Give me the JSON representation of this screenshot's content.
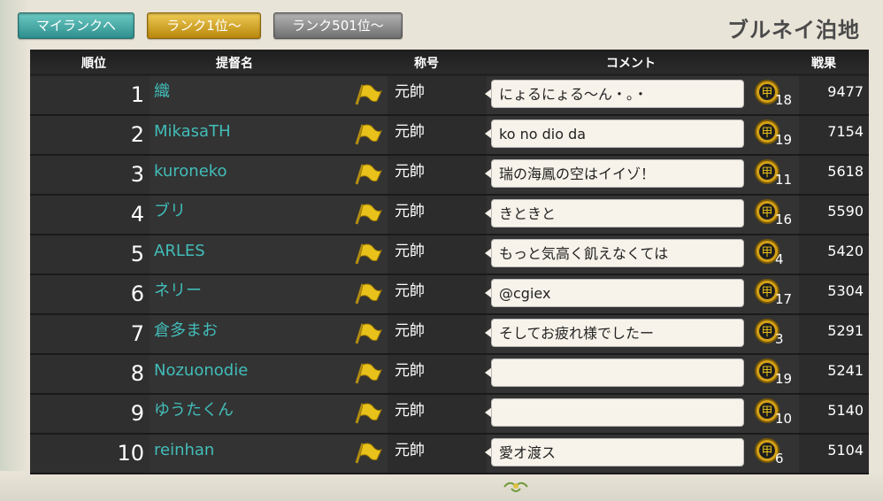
{
  "tabs": {
    "my_rank": "マイランクへ",
    "rank1": "ランク1位～",
    "rank501": "ランク501位～"
  },
  "base_name": "ブルネイ泊地",
  "header": {
    "rank": "順位",
    "name": "提督名",
    "title": "称号",
    "comment": "コメント",
    "score": "戦果"
  },
  "rows": [
    {
      "rank": "1",
      "name": "織",
      "title": "元帥",
      "comment": "にょるにょる～ん・。・",
      "medals": "18",
      "score": "9477"
    },
    {
      "rank": "2",
      "name": "MikasaTH",
      "title": "元帥",
      "comment": "ko no dio da",
      "medals": "19",
      "score": "7154"
    },
    {
      "rank": "3",
      "name": "kuroneko",
      "title": "元帥",
      "comment": "瑞の海鳳の空はイイゾ！",
      "medals": "11",
      "score": "5618"
    },
    {
      "rank": "4",
      "name": "ブリ",
      "title": "元帥",
      "comment": "きときと",
      "medals": "16",
      "score": "5590"
    },
    {
      "rank": "5",
      "name": "ARLES",
      "title": "元帥",
      "comment": "もっと気高く飢えなくては",
      "medals": "4",
      "score": "5420"
    },
    {
      "rank": "6",
      "name": "ネリー",
      "title": "元帥",
      "comment": "@cgiex",
      "medals": "17",
      "score": "5304"
    },
    {
      "rank": "7",
      "name": "倉多まお",
      "title": "元帥",
      "comment": "そしてお疲れ様でしたー",
      "medals": "3",
      "score": "5291"
    },
    {
      "rank": "8",
      "name": "Nozuonodie",
      "title": "元帥",
      "comment": "",
      "medals": "19",
      "score": "5241"
    },
    {
      "rank": "9",
      "name": "ゆうたくん",
      "title": "元帥",
      "comment": "",
      "medals": "10",
      "score": "5140"
    },
    {
      "rank": "10",
      "name": "reinhan",
      "title": "元帥",
      "comment": "愛オ渡ス",
      "medals": "6",
      "score": "5104"
    }
  ],
  "colors": {
    "name_text": "#42bdb9",
    "flag": "#e8c21a",
    "medal": "#d4a017"
  },
  "icons": {
    "flag": "admiral-flag-icon",
    "medal": "kou-medal-icon",
    "ornament": "leaf-ornament-icon"
  }
}
